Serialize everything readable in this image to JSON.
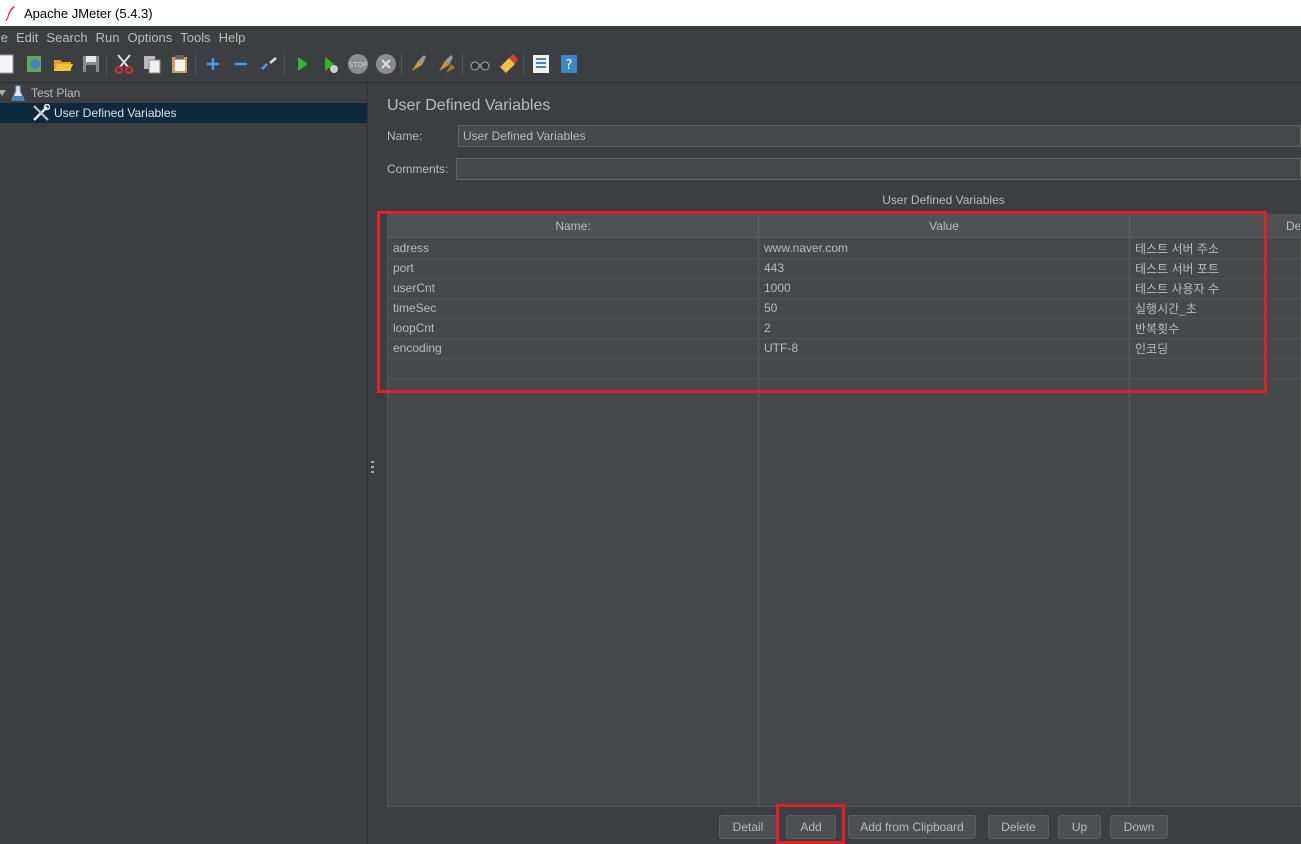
{
  "window": {
    "title": "Apache JMeter (5.4.3)"
  },
  "menu": [
    "ile",
    "Edit",
    "Search",
    "Run",
    "Options",
    "Tools",
    "Help"
  ],
  "toolbar_icons": [
    "new-icon",
    "templates-icon",
    "open-icon",
    "save-icon",
    "cut-icon",
    "copy-icon",
    "paste-icon",
    "expand-icon",
    "collapse-icon",
    "toggle-icon",
    "start-icon",
    "start-no-pause-icon",
    "stop-icon",
    "shutdown-icon",
    "clear-icon",
    "clear-all-icon",
    "search-icon",
    "reset-search-icon",
    "function-helper-icon",
    "help-icon"
  ],
  "tree": {
    "items": [
      {
        "label": "Test Plan",
        "icon": "flask-icon"
      },
      {
        "label": "User Defined Variables",
        "icon": "wrench-icon"
      }
    ]
  },
  "panel": {
    "title": "User Defined Variables",
    "name_label": "Name:",
    "name_value": "User Defined Variables",
    "comments_label": "Comments:",
    "comments_value": "",
    "table_caption": "User Defined Variables"
  },
  "table": {
    "headers": [
      "Name:",
      "Value",
      "Des"
    ],
    "rows": [
      [
        "adress",
        "www.naver.com",
        "테스트 서버 주소"
      ],
      [
        "port",
        "443",
        "테스트 서버 포트"
      ],
      [
        "userCnt",
        "1000",
        "테스트 사용자 수"
      ],
      [
        "timeSec",
        "50",
        "실행시간_초"
      ],
      [
        "loopCnt",
        "2",
        "반복횟수"
      ],
      [
        "encoding",
        "UTF-8",
        "인코딩"
      ]
    ]
  },
  "buttons": {
    "detail": "Detail",
    "add": "Add",
    "add_from_clipboard": "Add from Clipboard",
    "delete": "Delete",
    "up": "Up",
    "down": "Down"
  },
  "colors": {
    "highlight": "#e0202a",
    "background": "#3c3f41",
    "selection": "#0d293e"
  }
}
